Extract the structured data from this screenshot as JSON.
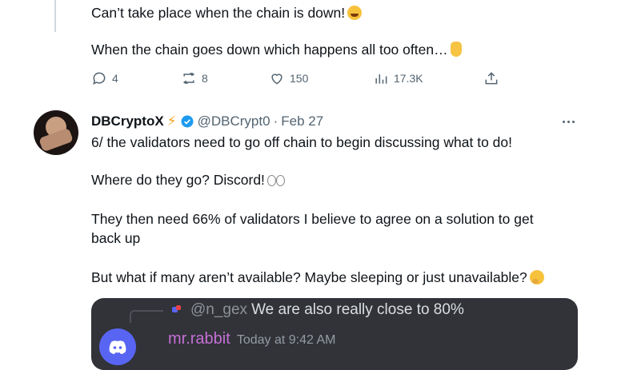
{
  "prev_tweet": {
    "line1": "Can’t take place when the chain is down!",
    "line1_emoji": "laughing-emoji",
    "line2": "When the chain goes down which happens all too often…",
    "line2_emoji": "pointing-down-emoji",
    "actions": {
      "replies": "4",
      "retweets": "8",
      "likes": "150",
      "views": "17.3K"
    }
  },
  "tweet": {
    "display_name": "DBCryptoX",
    "handle": "@DBCrypt0",
    "separator": "·",
    "date": "Feb 27",
    "lines": [
      "6/ the validators need to go off chain to begin discussing what to do!",
      "Where do they go? Discord!",
      "They then need 66% of validators I believe to agree on a solution to get",
      "back up",
      "But what if many aren’t available? Maybe sleeping or just unavailable?"
    ]
  },
  "discord": {
    "reply_user": "@n_gex",
    "reply_text": "We are also really close to 80%",
    "username": "mr.rabbit",
    "timestamp": "Today at 9:42 AM"
  },
  "colors": {
    "text": "#0f1419",
    "muted": "#536471",
    "verified": "#1d9bf0",
    "discord_bg": "#313338",
    "discord_username": "#c56fd6",
    "discord_blurple": "#5865f2"
  }
}
